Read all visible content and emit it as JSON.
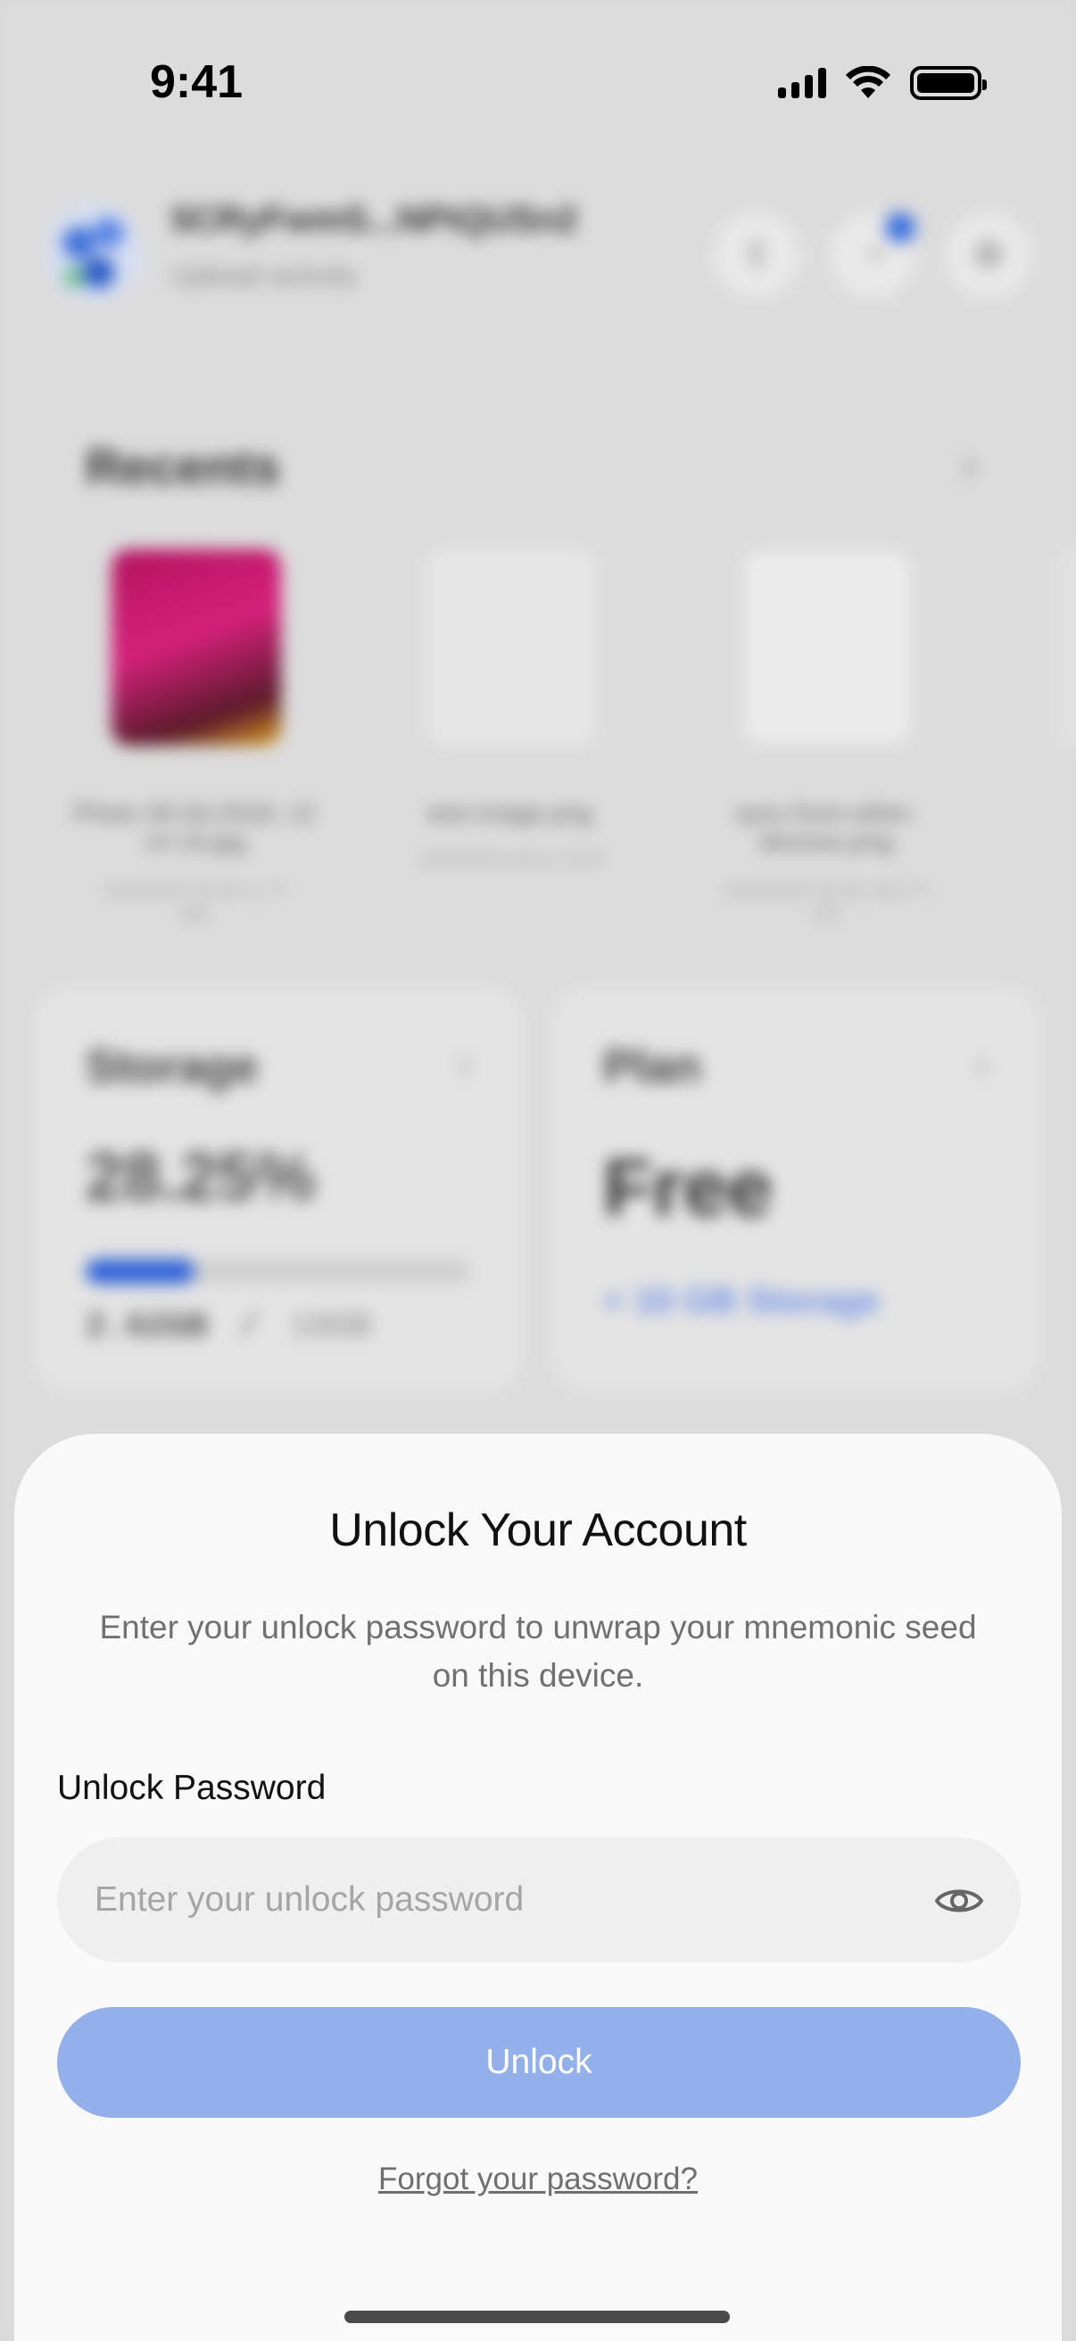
{
  "status_bar": {
    "time": "9:41"
  },
  "header": {
    "account_id": "5CRyFwmS...NPtQUSn2",
    "subtitle": "Upload activity"
  },
  "recents": {
    "title": "Recents",
    "items": [
      {
        "name": "Photo 30-03-2018, 12 14 10.jpg",
        "meta": "10/9/2025 00:00 2.77 MB"
      },
      {
        "name": "test image.png",
        "meta": "10/9/2025 08:11 20 B"
      },
      {
        "name": "sync-from-other-devices.png",
        "meta": "10/9/2025 00:00 420.77 KB"
      }
    ]
  },
  "storage": {
    "title": "Storage",
    "percent": "28.25%",
    "fill_fraction": 0.2825,
    "used": "2.62GB",
    "separator": "/",
    "total": "10GB"
  },
  "plan": {
    "title": "Plan",
    "value": "Free",
    "extra": "+ 10 GB Storage"
  },
  "sheet": {
    "title": "Unlock Your Account",
    "description": "Enter your unlock password to unwrap your mnemonic seed on this device.",
    "password_label": "Unlock Password",
    "password_placeholder": "Enter your unlock password",
    "unlock_button": "Unlock",
    "forgot_link": "Forgot your password?"
  },
  "colors": {
    "accent": "#2f62d8",
    "button_disabled": "#94b0ea",
    "sheet_bg": "#f9f9f9"
  },
  "icons": {
    "upload": "upload-icon",
    "notifications": "bell-icon",
    "settings": "gear-icon",
    "visibility": "eye-icon"
  }
}
